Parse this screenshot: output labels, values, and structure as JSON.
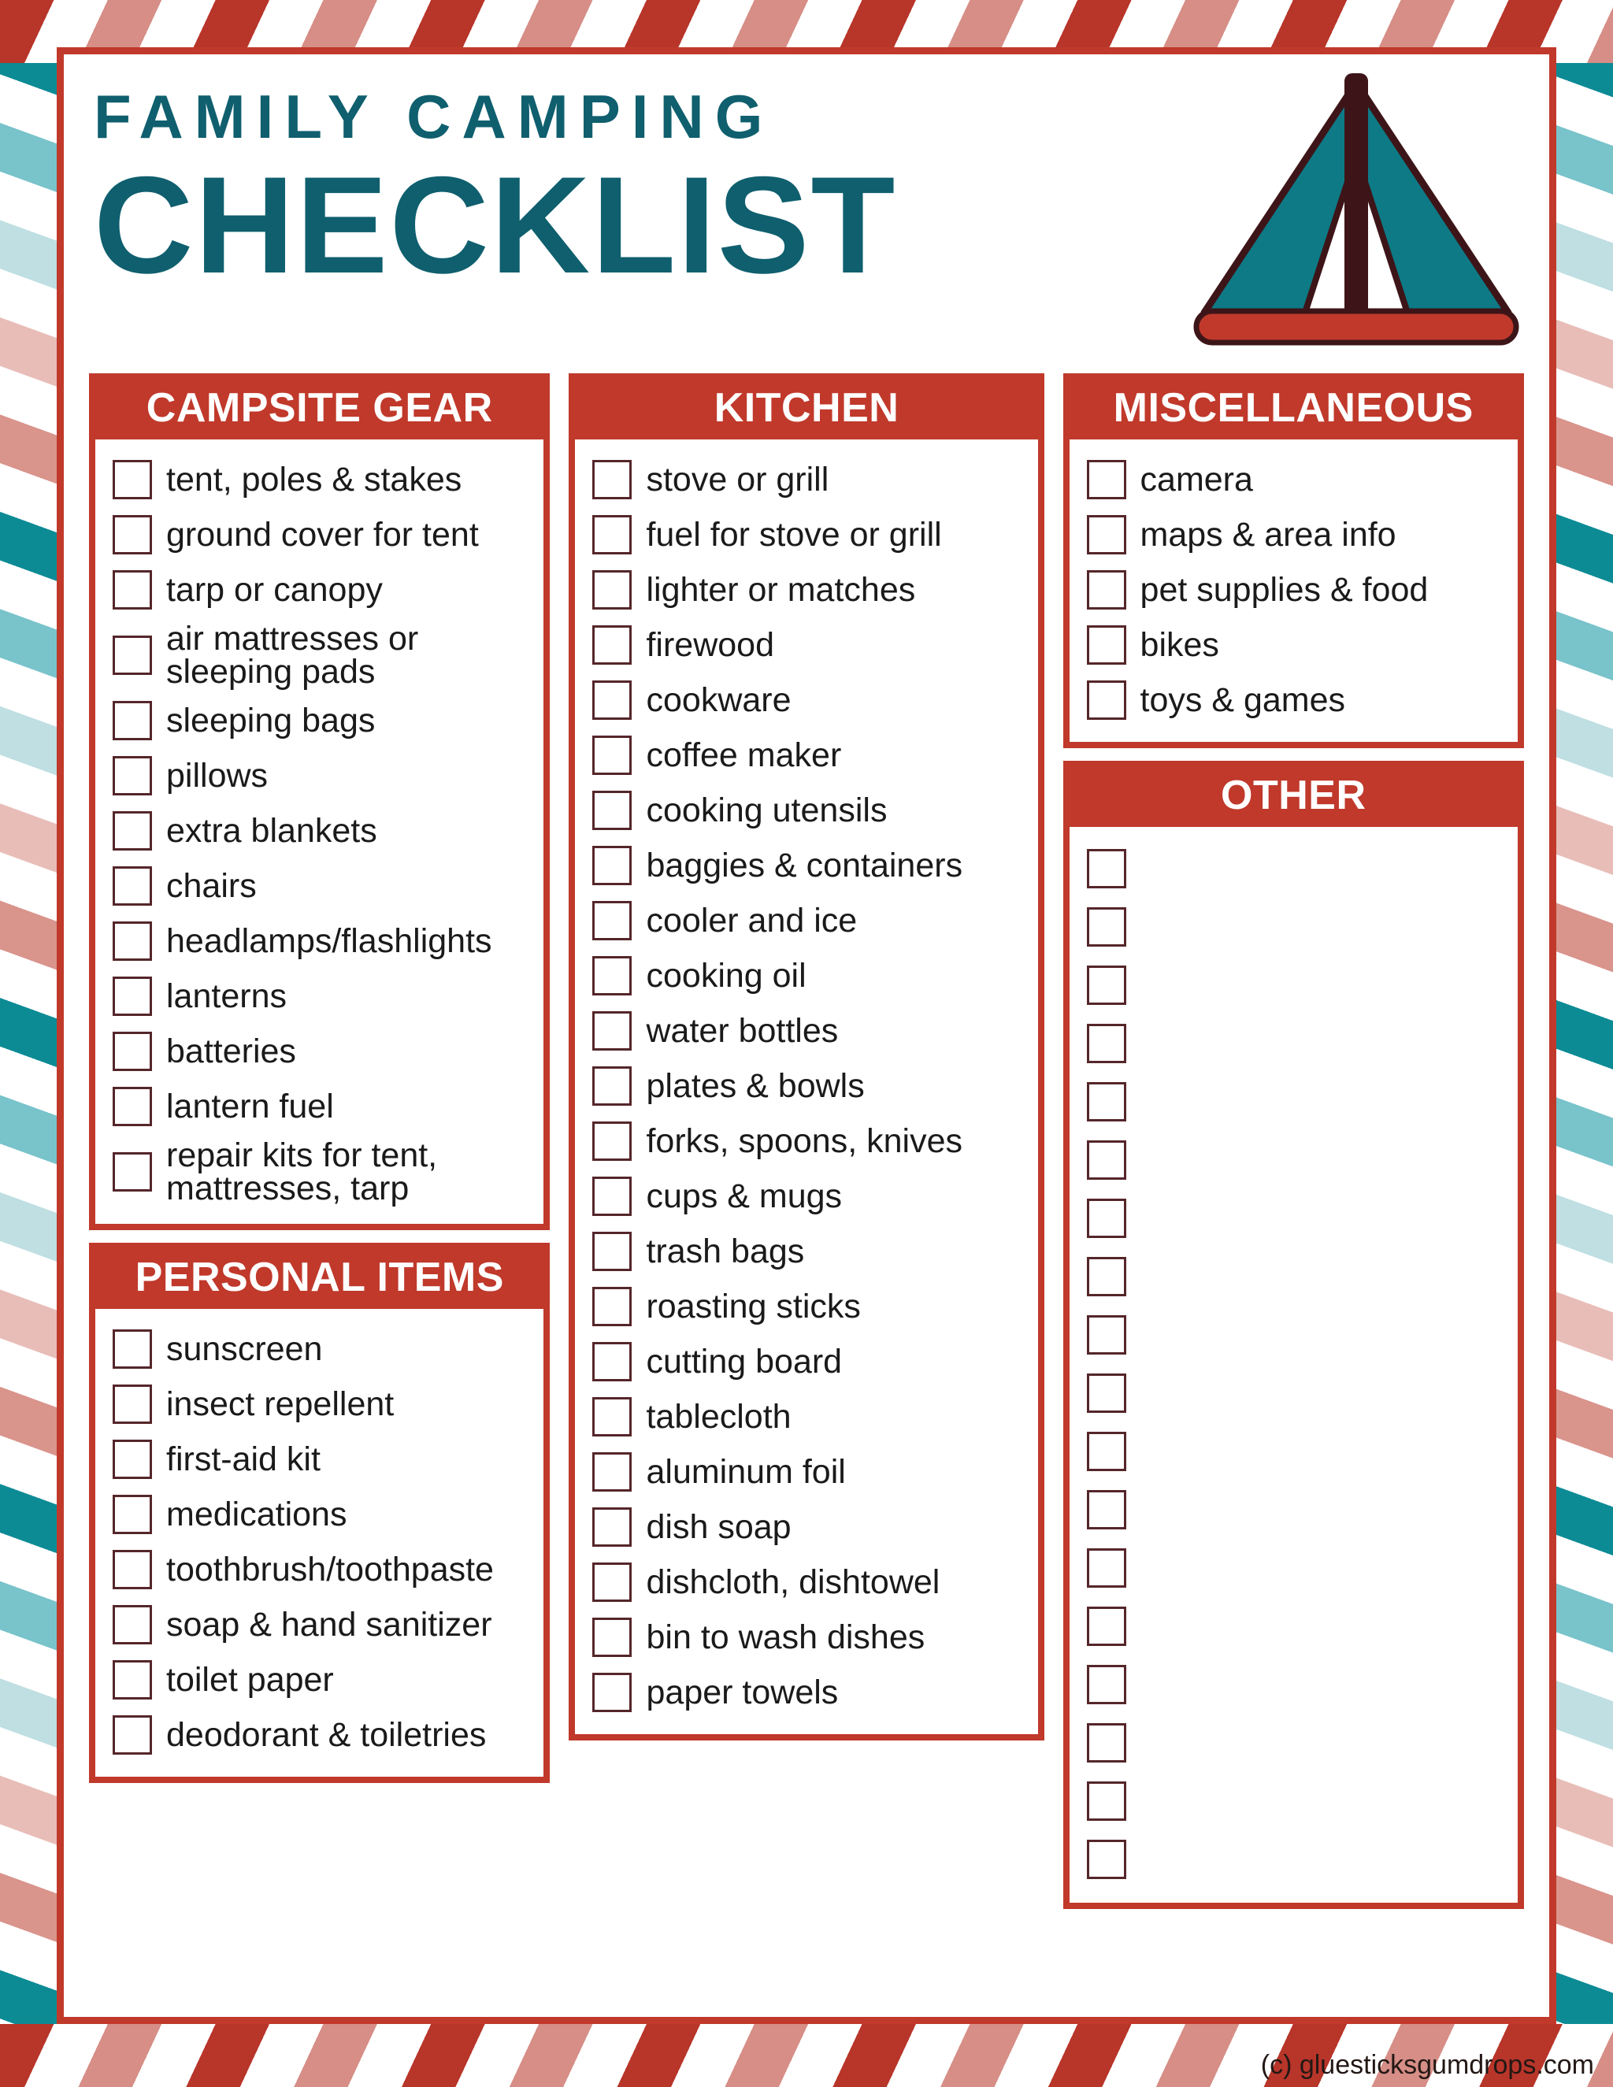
{
  "header": {
    "title_line1": "FAMILY CAMPING",
    "title_line2": "CHECKLIST",
    "tent_icon": "tent-icon"
  },
  "colors": {
    "red": "#c0392b",
    "teal": "#0f5f6e",
    "tent_panel": "#0d7a86",
    "tent_outline": "#3d1518",
    "checkbox_border": "#55262a"
  },
  "sections": {
    "campsite_gear": {
      "title": "CAMPSITE GEAR",
      "items": [
        "tent, poles & stakes",
        "ground cover for tent",
        "tarp or canopy",
        "air mattresses or\nsleeping pads",
        "sleeping bags",
        "pillows",
        "extra blankets",
        "chairs",
        "headlamps/flashlights",
        "lanterns",
        "batteries",
        "lantern fuel",
        "repair kits for tent,\nmattresses, tarp"
      ]
    },
    "personal_items": {
      "title": "PERSONAL ITEMS",
      "items": [
        "sunscreen",
        "insect repellent",
        "first-aid kit",
        "medications",
        "toothbrush/toothpaste",
        "soap & hand sanitizer",
        "toilet paper",
        "deodorant & toiletries"
      ]
    },
    "kitchen": {
      "title": "KITCHEN",
      "items": [
        "stove or grill",
        "fuel for stove or grill",
        "lighter or matches",
        "firewood",
        "cookware",
        "coffee maker",
        "cooking utensils",
        "baggies & containers",
        "cooler and ice",
        "cooking oil",
        "water bottles",
        "plates & bowls",
        "forks, spoons, knives",
        "cups & mugs",
        "trash bags",
        "roasting sticks",
        "cutting board",
        "tablecloth",
        "aluminum foil",
        "dish soap",
        "dishcloth, dishtowel",
        "bin to wash dishes",
        "paper towels"
      ]
    },
    "miscellaneous": {
      "title": "MISCELLANEOUS",
      "items": [
        "camera",
        "maps & area info",
        "pet supplies & food",
        "bikes",
        "toys & games"
      ]
    },
    "other": {
      "title": "OTHER",
      "blank_row_count": 18,
      "items": []
    }
  },
  "footer": {
    "credit": "(c) gluesticksgumdrops.com"
  }
}
